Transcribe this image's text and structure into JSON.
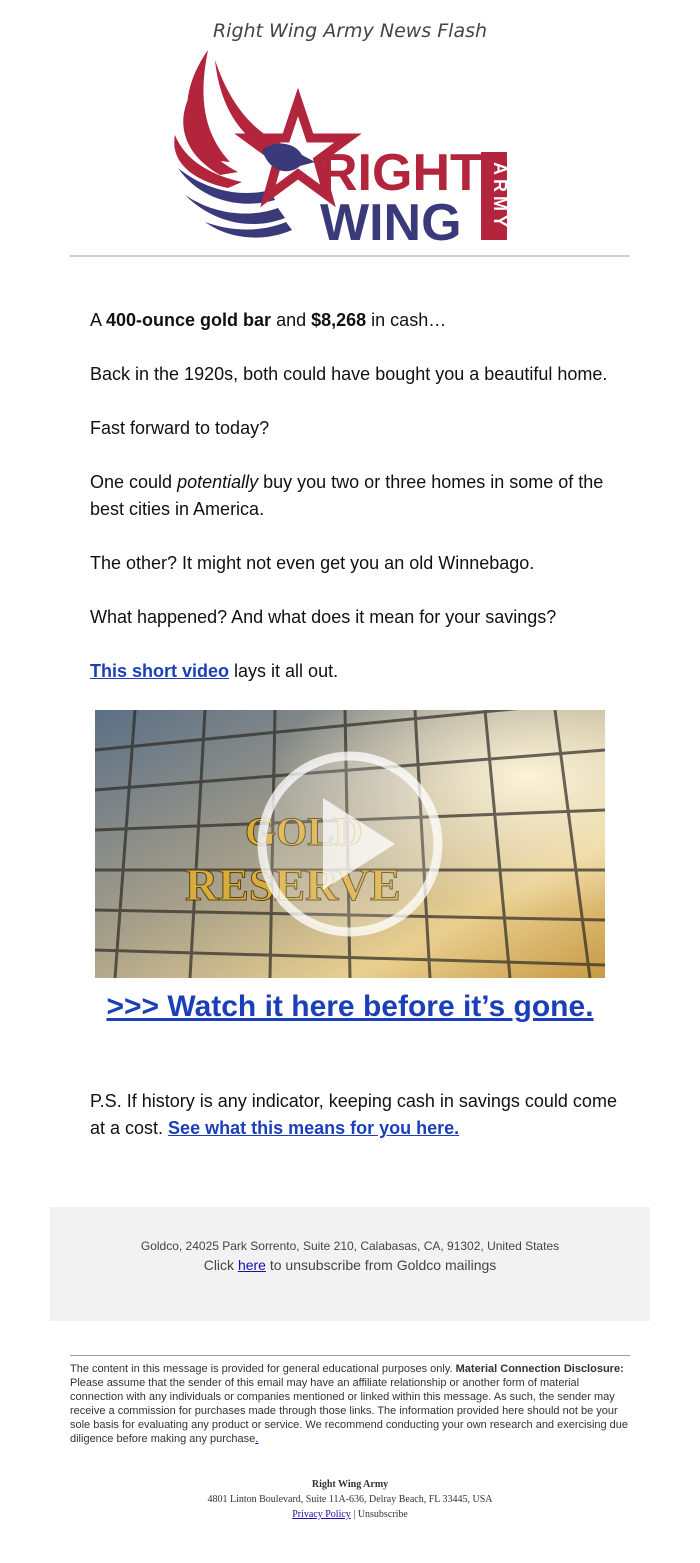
{
  "header": {
    "title": "Right Wing Army News Flash"
  },
  "logo": {
    "word1": "RIGHT",
    "word2": "WING",
    "vertical": "ARMY",
    "colors": {
      "red": "#b3253c",
      "navy": "#3a3a7a"
    }
  },
  "body": {
    "p1": {
      "pre": "A ",
      "b1": "400-ounce gold bar",
      "mid": " and ",
      "b2": "$8,268",
      "post": " in cash…"
    },
    "p2": "Back in the 1920s, both could have bought you a beautiful home.",
    "p3": "Fast forward to today?",
    "p4": {
      "pre": "One could ",
      "em": "potentially",
      "post": " buy you two or three homes in some of the best cities in America."
    },
    "p5": "The other? It might not even get you an old Winnebago.",
    "p6": "What happened? And what does it mean for your savings?",
    "p7": {
      "link": "This short video",
      "post": " lays it all out."
    }
  },
  "video": {
    "sign_line1": "GOLD",
    "sign_line2": "RESERVE"
  },
  "cta": {
    "label": ">>> Watch it here before it’s gone."
  },
  "ps": {
    "pre": "P.S. If history is any indicator, keeping cash in savings could come at a cost. ",
    "link": "See what this means for you here."
  },
  "footer": {
    "address": "Goldco, 24025 Park Sorrento, Suite 210, Calabasas, CA, 91302, United States",
    "unsub_pre": "Click ",
    "unsub_link": "here",
    "unsub_post": " to unsubscribe from Goldco mailings"
  },
  "disclaimer": {
    "pre": "The content in this message is provided for general educational purposes only. ",
    "bold": "Material Connection Disclosure:",
    "post": " Please assume that the sender of this email may have an affiliate relationship or another form of material connection with any individuals or companies mentioned or linked within this message. As such, the sender may receive a commission for purchases made through those links. The information provided here should not be your sole basis for evaluating any product or service. We recommend conducting your own research and exercising due diligence before making any purchase",
    "end": "."
  },
  "signoff": {
    "name": "Right Wing Army",
    "address": "4801 Linton Boulevard, Suite 11A-636, Delray Beach, FL 33445, USA",
    "privacy": "Privacy Policy",
    "sep": " | ",
    "unsubscribe": "Unsubscribe"
  }
}
